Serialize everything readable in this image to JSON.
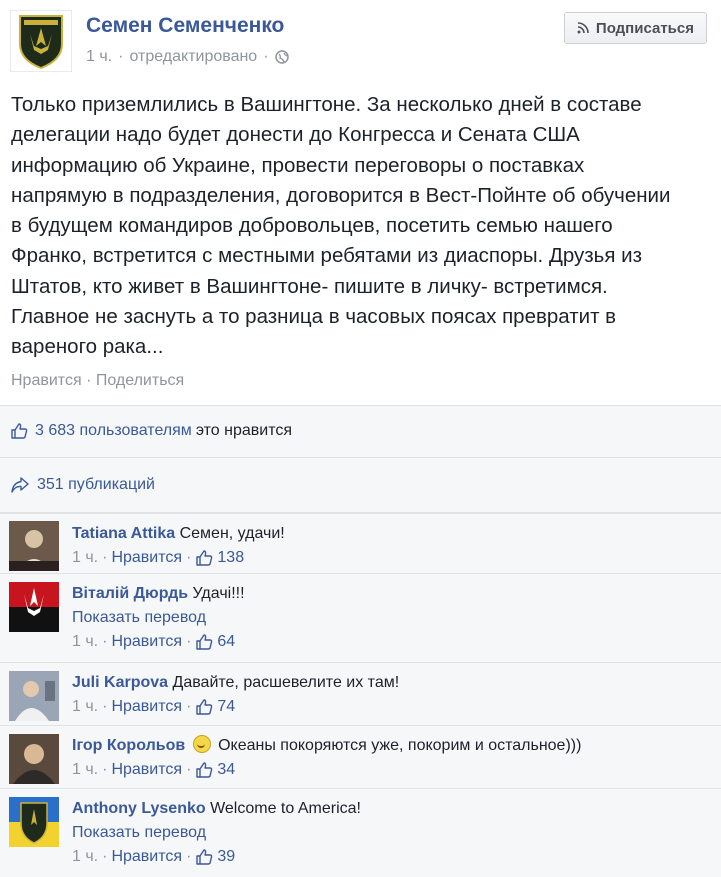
{
  "post": {
    "author": "Семен Семенченко",
    "meta_time": "1 ч.",
    "meta_edited": "отредактировано",
    "subscribe_label": "Подписаться",
    "text_lines": [
      "Только приземлились в Вашингтоне. За несколько дней в составе",
      "делегации надо будет донести до Конгресса и Сената США",
      "информацию об Украине, провести переговоры о поставках",
      "напрямую в подразделения, договорится в Вест-Пойнте об обучении",
      "в будущем командиров добровольцев, посетить семью нашего",
      "Франко, встретится с местными ребятами из диаспоры. Друзья из",
      "Штатов, кто живет в Вашингтоне- пишите в личку- встретимся.",
      "Главное не заснуть а то разница в часовых поясах превратит в",
      "вареного рака..."
    ],
    "actions": {
      "like": "Нравится",
      "share": "Поделиться"
    }
  },
  "stats": {
    "likes_text": "3 683 пользователям",
    "likes_suffix": "это нравится",
    "shares_text": "351 публикаций"
  },
  "comments": [
    {
      "name": "Tatiana Attika",
      "text": "Семен, удачи!",
      "translate": "",
      "time": "1 ч.",
      "like_label": "Нравится",
      "likes": "138"
    },
    {
      "name": "Віталій Дюрдь",
      "text": "Удачі!!!",
      "translate": "Показать перевод",
      "time": "1 ч.",
      "like_label": "Нравится",
      "likes": "64"
    },
    {
      "name": "Juli Karpova",
      "text": "Давайте, расшевелите их там!",
      "translate": "",
      "time": "1 ч.",
      "like_label": "Нравится",
      "likes": "74"
    },
    {
      "name": "Ігор Корольов",
      "text": "Океаны покоряются уже, покорим и остальное)))",
      "translate": "",
      "time": "1 ч.",
      "like_label": "Нравится",
      "likes": "34"
    },
    {
      "name": "Anthony Lysenko",
      "text": "Welcome to America!",
      "translate": "Показать перевод",
      "time": "1 ч.",
      "like_label": "Нравится",
      "likes": "39"
    }
  ],
  "colors": {
    "link": "#3b5998",
    "muted": "#90949c",
    "panel": "#f6f7f9"
  }
}
